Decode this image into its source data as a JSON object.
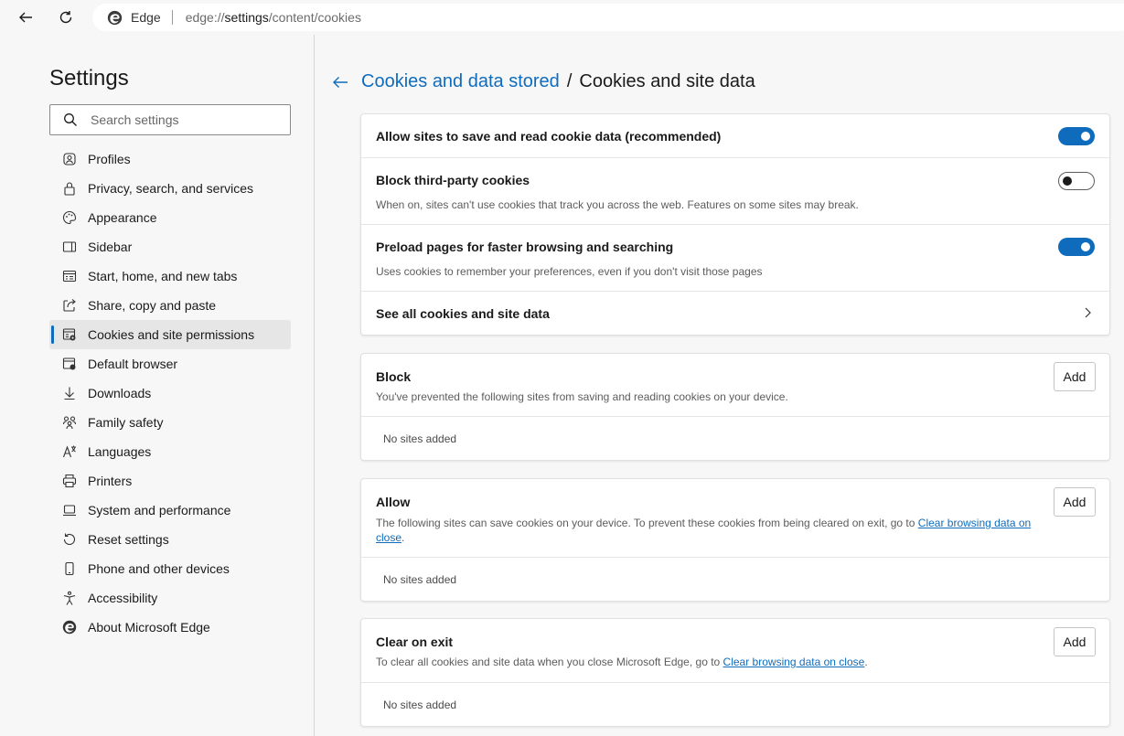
{
  "browser": {
    "brand": "Edge",
    "url_prefix": "edge://",
    "url_main": "settings",
    "url_suffix": "/content/cookies"
  },
  "sidebar": {
    "title": "Settings",
    "search_placeholder": "Search settings",
    "items": [
      {
        "label": "Profiles",
        "icon": "profile-icon"
      },
      {
        "label": "Privacy, search, and services",
        "icon": "lock-icon"
      },
      {
        "label": "Appearance",
        "icon": "palette-icon"
      },
      {
        "label": "Sidebar",
        "icon": "sidebar-icon"
      },
      {
        "label": "Start, home, and new tabs",
        "icon": "home-tabs-icon"
      },
      {
        "label": "Share, copy and paste",
        "icon": "share-icon"
      },
      {
        "label": "Cookies and site permissions",
        "icon": "cookie-permissions-icon",
        "active": true
      },
      {
        "label": "Default browser",
        "icon": "default-browser-icon"
      },
      {
        "label": "Downloads",
        "icon": "download-icon"
      },
      {
        "label": "Family safety",
        "icon": "family-icon"
      },
      {
        "label": "Languages",
        "icon": "languages-icon"
      },
      {
        "label": "Printers",
        "icon": "printer-icon"
      },
      {
        "label": "System and performance",
        "icon": "laptop-icon"
      },
      {
        "label": "Reset settings",
        "icon": "reset-icon"
      },
      {
        "label": "Phone and other devices",
        "icon": "phone-icon"
      },
      {
        "label": "Accessibility",
        "icon": "accessibility-icon"
      },
      {
        "label": "About Microsoft Edge",
        "icon": "edge-logo-icon"
      }
    ]
  },
  "main": {
    "breadcrumb_parent": "Cookies and data stored",
    "breadcrumb_separator": "/",
    "breadcrumb_current": "Cookies and site data",
    "settings": {
      "allow_sites": {
        "title": "Allow sites to save and read cookie data (recommended)",
        "enabled": true
      },
      "block_third_party": {
        "title": "Block third-party cookies",
        "desc": "When on, sites can't use cookies that track you across the web. Features on some sites may break.",
        "enabled": false
      },
      "preload": {
        "title": "Preload pages for faster browsing and searching",
        "desc": "Uses cookies to remember your preferences, even if you don't visit those pages",
        "enabled": true
      },
      "see_all": {
        "title": "See all cookies and site data"
      }
    },
    "block": {
      "title": "Block",
      "desc": "You've prevented the following sites from saving and reading cookies on your device.",
      "add_label": "Add",
      "empty": "No sites added"
    },
    "allow": {
      "title": "Allow",
      "desc_before": "The following sites can save cookies on your device. To prevent these cookies from being cleared on exit, go to ",
      "link_part1": "Clear browsing data on",
      "link_part2": "close",
      "desc_after": ".",
      "add_label": "Add",
      "empty": "No sites added"
    },
    "clear_on_exit": {
      "title": "Clear on exit",
      "desc_before": "To clear all cookies and site data when you close Microsoft Edge, go to ",
      "link": "Clear browsing data on close",
      "desc_after": ".",
      "add_label": "Add",
      "empty": "No sites added"
    }
  },
  "colors": {
    "accent": "#0f6cbd",
    "background": "#f7f7f7"
  }
}
